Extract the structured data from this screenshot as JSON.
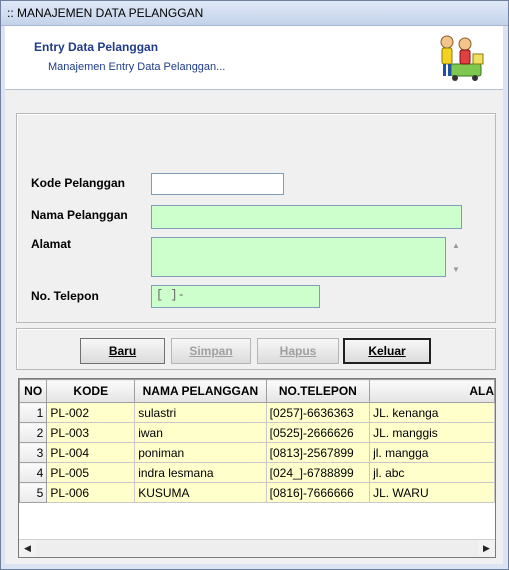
{
  "window": {
    "title": ":: MANAJEMEN DATA PELANGGAN"
  },
  "header": {
    "title": "Entry Data Pelanggan",
    "subtitle": "Manajemen Entry Data Pelanggan..."
  },
  "form": {
    "kode_label": "Kode Pelanggan",
    "kode_value": "",
    "nama_label": "Nama Pelanggan",
    "nama_value": "",
    "alamat_label": "Alamat",
    "alamat_value": "",
    "telepon_label": "No. Telepon",
    "telepon_mask": "[   ]-"
  },
  "buttons": {
    "baru": "Baru",
    "simpan": "Simpan",
    "hapus": "Hapus",
    "keluar": "Keluar"
  },
  "table": {
    "columns": [
      "NO",
      "KODE",
      "NAMA PELANGGAN",
      "NO.TELEPON",
      "ALA"
    ],
    "rows": [
      [
        "1",
        "PL-002",
        "sulastri",
        "[0257]-6636363",
        "JL. kenanga"
      ],
      [
        "2",
        "PL-003",
        "iwan",
        "[0525]-2666626",
        "JL. manggis"
      ],
      [
        "3",
        "PL-004",
        "poniman",
        "[0813]-2567899",
        "jl. mangga"
      ],
      [
        "4",
        "PL-005",
        "indra lesmana",
        "[024_]-6788899",
        "jl. abc"
      ],
      [
        "5",
        "PL-006",
        "KUSUMA",
        "[0816]-7666666",
        "JL. WARU"
      ]
    ]
  },
  "colors": {
    "header_text": "#1f3c88",
    "input_green": "#ccffcc",
    "row_yellow": "#ffffcc"
  },
  "icons": [
    "people-icon",
    "scroll-left-icon",
    "scroll-right-icon",
    "scroll-up-icon",
    "scroll-down-icon"
  ]
}
